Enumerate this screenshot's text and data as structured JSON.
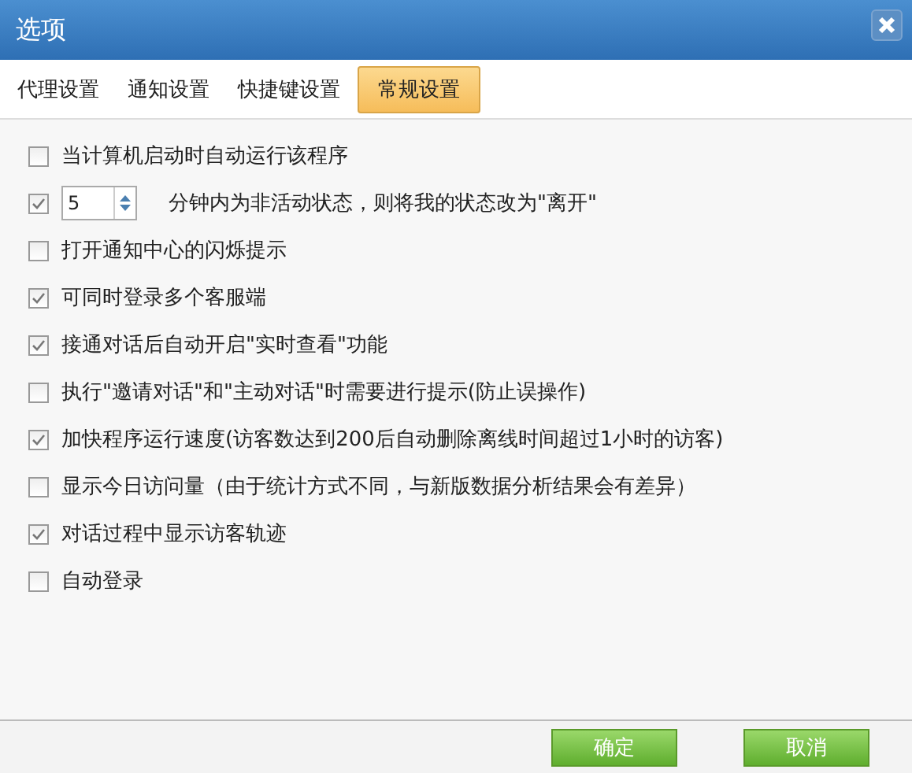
{
  "window": {
    "title": "选项"
  },
  "tabs": [
    {
      "label": "代理设置",
      "selected": false
    },
    {
      "label": "通知设置",
      "selected": false
    },
    {
      "label": "快捷键设置",
      "selected": false
    },
    {
      "label": "常规设置",
      "selected": true
    }
  ],
  "options": [
    {
      "kind": "checkbox",
      "text": "当计算机启动时自动运行该程序",
      "checked": false
    },
    {
      "kind": "spinner",
      "checked": true,
      "minutes": "5",
      "text": "分钟内为非活动状态，则将我的状态改为\"离开\""
    },
    {
      "kind": "checkbox",
      "text": "打开通知中心的闪烁提示",
      "checked": false
    },
    {
      "kind": "checkbox",
      "text": "可同时登录多个客服端",
      "checked": true
    },
    {
      "kind": "checkbox",
      "text": "接通对话后自动开启\"实时查看\"功能",
      "checked": true
    },
    {
      "kind": "checkbox",
      "text": "执行\"邀请对话\"和\"主动对话\"时需要进行提示(防止误操作)",
      "checked": false
    },
    {
      "kind": "checkbox",
      "text": "加快程序运行速度(访客数达到200后自动删除离线时间超过1小时的访客)",
      "checked": true
    },
    {
      "kind": "checkbox",
      "text": "显示今日访问量（由于统计方式不同，与新版数据分析结果会有差异）",
      "checked": false
    },
    {
      "kind": "checkbox",
      "text": "对话过程中显示访客轨迹",
      "checked": true
    },
    {
      "kind": "checkbox",
      "text": "自动登录",
      "checked": false
    }
  ],
  "buttons": [
    "确定",
    "取消"
  ]
}
